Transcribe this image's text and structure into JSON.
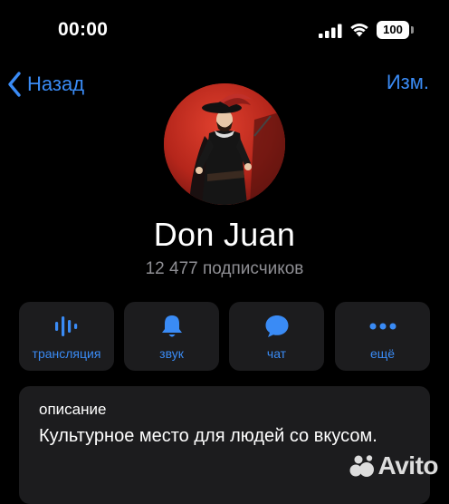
{
  "status": {
    "time": "00:00",
    "battery": "100"
  },
  "nav": {
    "back_label": "Назад",
    "edit_label": "Изм."
  },
  "channel": {
    "name": "Don Juan",
    "subscribers": "12 477 подписчиков"
  },
  "actions": [
    {
      "label": "трансляция",
      "icon": "broadcast-icon"
    },
    {
      "label": "звук",
      "icon": "bell-icon"
    },
    {
      "label": "чат",
      "icon": "chat-bubble-icon"
    },
    {
      "label": "ещё",
      "icon": "more-dots-icon"
    }
  ],
  "description": {
    "title": "описание",
    "text": "Культурное место для людей со вкусом."
  },
  "watermark": {
    "text": "Avito"
  },
  "colors": {
    "accent": "#3a8bf5",
    "card": "#1c1c1e",
    "background": "#000000",
    "secondary_text": "#8e8e93"
  }
}
